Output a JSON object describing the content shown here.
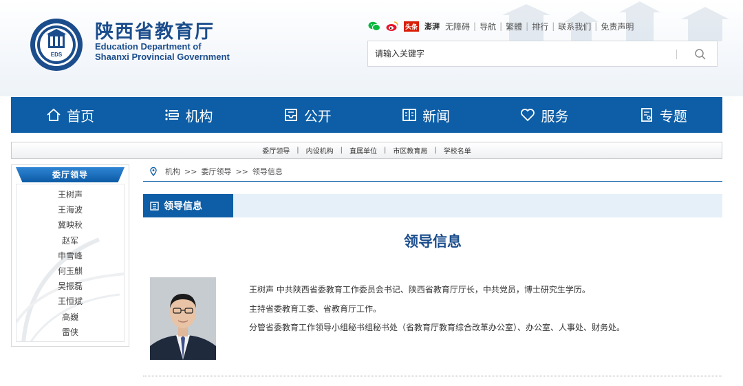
{
  "site": {
    "title_cn": "陕西省教育厅",
    "title_en_line1": "Education Department of",
    "title_en_line2": "Shaanxi Provincial Government",
    "emblem_text": "EDS"
  },
  "toplinks": {
    "icons": [
      "wechat-icon",
      "weibo-icon",
      "toutiao-icon",
      "pengpai-icon"
    ],
    "toutiao_label": "头条",
    "pengpai_label": "澎湃",
    "items": [
      "无障碍",
      "导航",
      "繁體",
      "排行",
      "联系我们",
      "免责声明"
    ]
  },
  "search": {
    "placeholder": "请输入关键字"
  },
  "nav": {
    "items": [
      {
        "label": "首页",
        "icon": "home-icon"
      },
      {
        "label": "机构",
        "icon": "list-icon"
      },
      {
        "label": "公开",
        "icon": "inbox-icon"
      },
      {
        "label": "新闻",
        "icon": "book-icon"
      },
      {
        "label": "服务",
        "icon": "heart-icon"
      },
      {
        "label": "专题",
        "icon": "document-icon"
      }
    ]
  },
  "subnav": {
    "items": [
      "委厅领导",
      "内设机构",
      "直属单位",
      "市区教育局",
      "学校名单"
    ]
  },
  "sidebar": {
    "title": "委厅领导",
    "items": [
      "王树声",
      "王海波",
      "冀映秋",
      "赵军",
      "申雪峰",
      "何玉麒",
      "吴振磊",
      "王恒斌",
      "高巍",
      "雷侠"
    ]
  },
  "breadcrumb": {
    "items": [
      "机构",
      "委厅领导",
      "领导信息"
    ],
    "sep": ">>"
  },
  "section": {
    "tab_label": "领导信息"
  },
  "content": {
    "title": "领导信息",
    "bio_lines": [
      "王树声 中共陕西省委教育工作委员会书记、陕西省教育厅厅长，中共党员，博士研究生学历。",
      "主持省委教育工委、省教育厅工作。",
      "分管省委教育工作领导小组秘书组秘书处（省教育厅教育综合改革办公室）、办公室、人事处、财务处。"
    ]
  },
  "colors": {
    "primary": "#0d5ea6",
    "title": "#1b4d8c",
    "light_bar": "#e6f0f8"
  }
}
